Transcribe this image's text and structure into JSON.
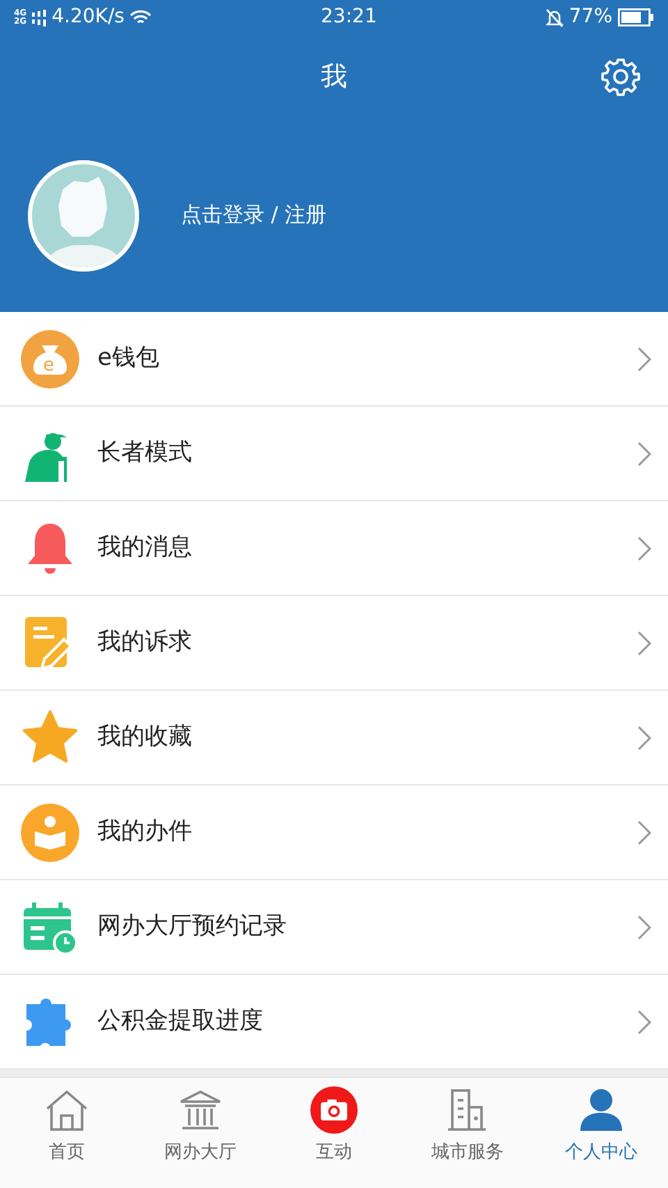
{
  "status_bar": {
    "network_types": [
      "4G",
      "2G"
    ],
    "speed": "4.20K/s",
    "time": "23:21",
    "battery": "77%"
  },
  "header": {
    "title": "我",
    "login_text": "点击登录 / 注册"
  },
  "menu": [
    {
      "label": "e钱包",
      "icon_text": "e"
    },
    {
      "label": "长者模式"
    },
    {
      "label": "我的消息"
    },
    {
      "label": "我的诉求"
    },
    {
      "label": "我的收藏"
    },
    {
      "label": "我的办件"
    },
    {
      "label": "网办大厅预约记录"
    },
    {
      "label": "公积金提取进度"
    }
  ],
  "tabs": [
    {
      "label": "首页",
      "selected": false
    },
    {
      "label": "网办大厅",
      "selected": false
    },
    {
      "label": "互动",
      "selected": false
    },
    {
      "label": "城市服务",
      "selected": false
    },
    {
      "label": "个人中心",
      "selected": true
    }
  ]
}
